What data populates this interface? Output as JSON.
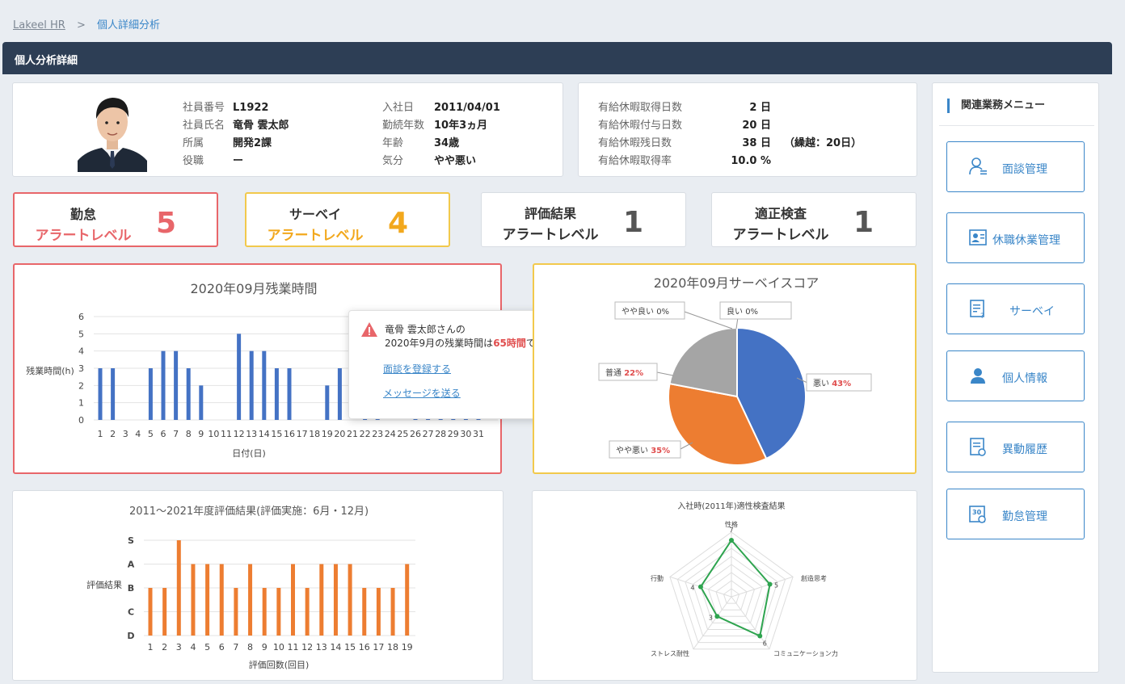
{
  "breadcrumb": {
    "home": "Lakeel HR",
    "sep": ">",
    "current": "個人詳細分析"
  },
  "page_title": "個人分析詳細",
  "profile": {
    "left": [
      {
        "label": "社員番号",
        "value": "L1922"
      },
      {
        "label": "社員氏名",
        "value": "竜骨 雲太郎"
      },
      {
        "label": "所属",
        "value": "開発2課"
      },
      {
        "label": "役職",
        "value": "ー"
      }
    ],
    "right": [
      {
        "label": "入社日",
        "value": "2011/04/01"
      },
      {
        "label": "勤続年数",
        "value": "10年3ヵ月"
      },
      {
        "label": "年齢",
        "value": "34歳"
      },
      {
        "label": "気分",
        "value": "やや悪い"
      }
    ]
  },
  "leave": [
    {
      "label": "有給休暇取得日数",
      "value": "2 日",
      "extra": ""
    },
    {
      "label": "有給休暇付与日数",
      "value": "20 日",
      "extra": ""
    },
    {
      "label": "有給休暇残日数",
      "value": "38 日",
      "extra": "（繰越：20日）"
    },
    {
      "label": "有給休暇取得率",
      "value": "10.0 %",
      "extra": ""
    }
  ],
  "alerts": [
    {
      "title": "勤怠",
      "sub": "アラートレベル",
      "level": "5",
      "color": "#e8666a",
      "border": "#e8666a"
    },
    {
      "title": "サーベイ",
      "sub": "アラートレベル",
      "level": "4",
      "color": "#f2a81d",
      "border": "#f2c94c"
    },
    {
      "title": "評価結果",
      "sub": "アラートレベル",
      "level": "1",
      "color": "#333333",
      "border": "#d8dde3"
    },
    {
      "title": "適正検査",
      "sub": "アラートレベル",
      "level": "1",
      "color": "#333333",
      "border": "#d8dde3"
    }
  ],
  "menu": {
    "title": "関連業務メニュー",
    "items": [
      {
        "label": "面談管理",
        "icon": "interview-user-icon"
      },
      {
        "label": "休職休業管理",
        "icon": "leave-management-icon"
      },
      {
        "label": "サーベイ",
        "icon": "survey-document-icon"
      },
      {
        "label": "個人情報",
        "icon": "person-icon"
      },
      {
        "label": "異動履歴",
        "icon": "transfer-history-icon"
      },
      {
        "label": "勤怠管理",
        "icon": "calendar-icon"
      }
    ]
  },
  "popup": {
    "line1": "竜骨 雲太郎さんの",
    "line2_pre": "2020年9月の残業時間は",
    "line2_em": "65時間",
    "line2_post": "です。",
    "link1": "面談を登録する",
    "link2": "メッセージを送る"
  },
  "chart_data": [
    {
      "type": "bar",
      "title": "2020年09月残業時間",
      "xlabel": "日付(日)",
      "ylabel": "残業時間(h)",
      "ylim": [
        0,
        6
      ],
      "yticks": [
        "0",
        "1",
        "2",
        "3",
        "4",
        "5",
        "6"
      ],
      "categories": [
        "1",
        "2",
        "3",
        "4",
        "5",
        "6",
        "7",
        "8",
        "9",
        "10",
        "11",
        "12",
        "13",
        "14",
        "15",
        "16",
        "17",
        "18",
        "19",
        "20",
        "21",
        "22",
        "23",
        "24",
        "25",
        "26",
        "27",
        "28",
        "29",
        "30",
        "31"
      ],
      "values": [
        3,
        3,
        0,
        0,
        3,
        4,
        4,
        3,
        2,
        0,
        0,
        5,
        4,
        4,
        3,
        3,
        0,
        0,
        2,
        3,
        null,
        null,
        null,
        null,
        null,
        null,
        null,
        null,
        null,
        null,
        null
      ],
      "color": "#4472c4"
    },
    {
      "type": "pie",
      "title": "2020年09月サーベイスコア",
      "slices": [
        {
          "label": "悪い",
          "pct": "43%",
          "value": 43,
          "color": "#4472c4"
        },
        {
          "label": "やや悪い",
          "pct": "35%",
          "value": 35,
          "color": "#ed7d31"
        },
        {
          "label": "普通",
          "pct": "22%",
          "value": 22,
          "color": "#a5a5a5"
        },
        {
          "label": "やや良い",
          "pct": "0%",
          "value": 0,
          "color": "#ffc000"
        },
        {
          "label": "良い",
          "pct": "0%",
          "value": 0,
          "color": "#5b9bd5"
        }
      ]
    },
    {
      "type": "bar",
      "title": "2011～2021年度評価結果(評価実施：6月・12月)",
      "xlabel": "評価回数(回目)",
      "ylabel": "評価結果",
      "grades": [
        "D",
        "C",
        "B",
        "A",
        "S"
      ],
      "categories": [
        "1",
        "2",
        "3",
        "4",
        "5",
        "6",
        "7",
        "8",
        "9",
        "10",
        "11",
        "12",
        "13",
        "14",
        "15",
        "16",
        "17",
        "18",
        "19"
      ],
      "values": [
        "B",
        "B",
        "S",
        "A",
        "A",
        "A",
        "B",
        "A",
        "B",
        "B",
        "A",
        "B",
        "A",
        "A",
        "A",
        "B",
        "B",
        "B",
        "A"
      ],
      "color": "#ed7d31"
    },
    {
      "type": "radar",
      "title": "入社時(2011年)適性検査結果",
      "axes": [
        "性格",
        "創造思考",
        "コミュニケーション力",
        "ストレス耐性",
        "行動"
      ],
      "values": [
        7,
        5,
        6,
        3,
        4
      ],
      "max": 8,
      "color": "#2ea44f"
    }
  ]
}
